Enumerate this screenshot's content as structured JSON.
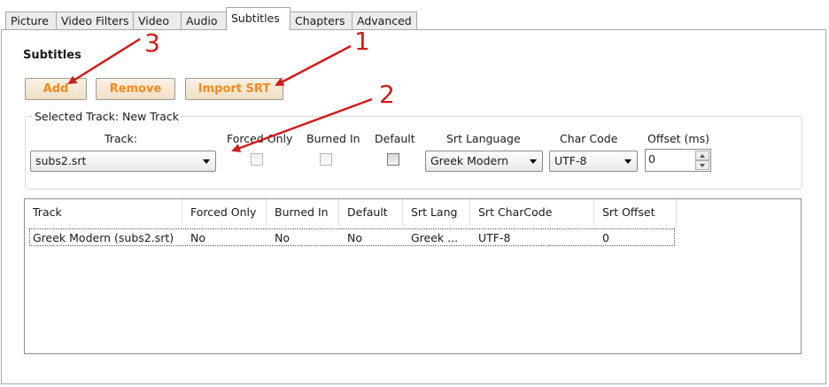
{
  "tabs": [
    "Picture",
    "Video Filters",
    "Video",
    "Audio",
    "Subtitles",
    "Chapters",
    "Advanced"
  ],
  "active_tab": "Subtitles",
  "section_title": "Subtitles",
  "buttons": {
    "add": "Add",
    "remove": "Remove",
    "import": "Import SRT"
  },
  "selected_track": {
    "legend": "Selected Track: New Track",
    "track_label": "Track:",
    "track_value": "subs2.srt",
    "forced_only_label": "Forced Only",
    "burned_in_label": "Burned In",
    "default_label": "Default",
    "srt_language_label": "Srt Language",
    "srt_language_value": "Greek Modern",
    "char_code_label": "Char Code",
    "char_code_value": "UTF-8",
    "offset_label": "Offset (ms)",
    "offset_value": "0"
  },
  "table": {
    "columns": [
      "Track",
      "Forced Only",
      "Burned In",
      "Default",
      "Srt Lang",
      "Srt CharCode",
      "Srt Offset"
    ],
    "rows": [
      [
        "Greek Modern (subs2.srt)",
        "No",
        "No",
        "No",
        "Greek ...",
        "UTF-8",
        "0"
      ]
    ]
  },
  "annotations": {
    "one": "1",
    "two": "2",
    "three": "3",
    "color": "#d01c1c"
  },
  "colors": {
    "button_text": "#f08a1c"
  }
}
